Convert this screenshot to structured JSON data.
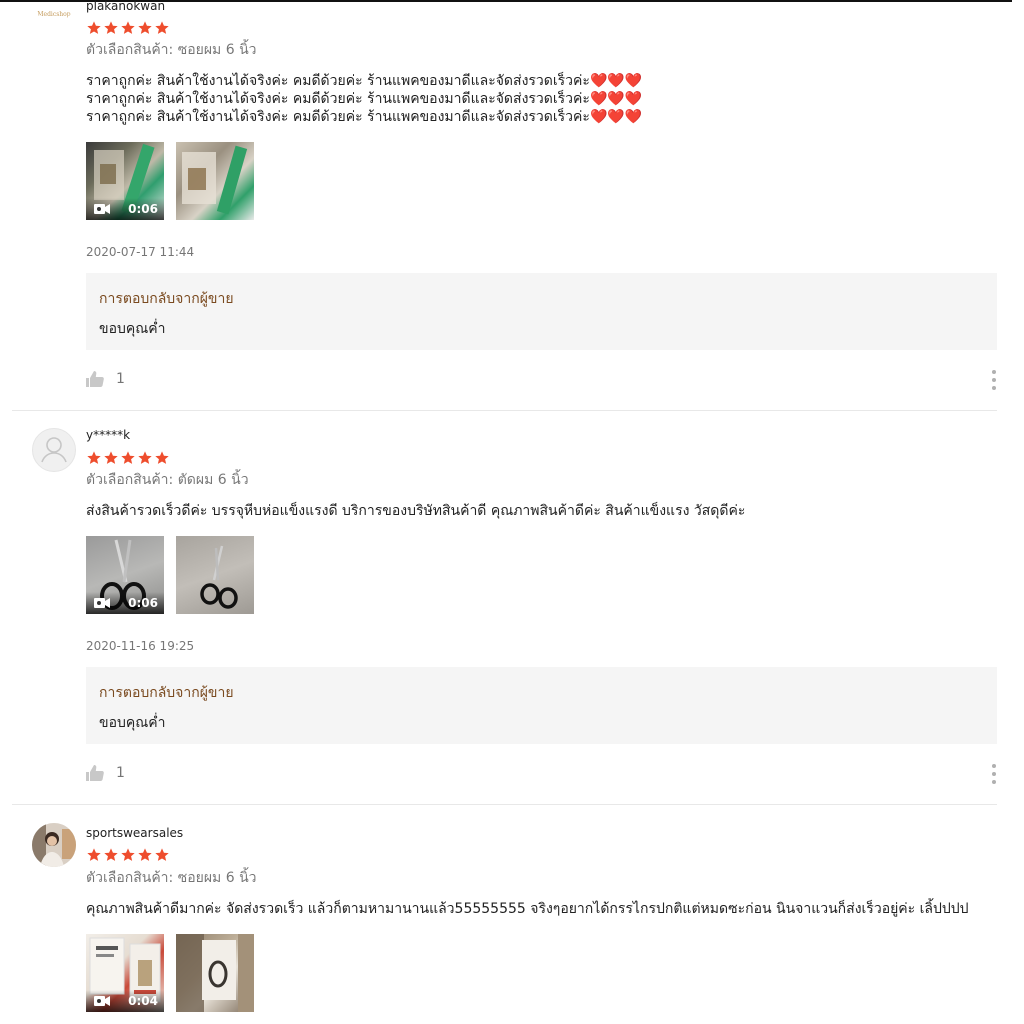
{
  "reviews": [
    {
      "username": "plakanokwan",
      "avatar_label": "Medicshop",
      "rating": 5,
      "variation": "ตัวเลือกสินค้า: ซอยผม 6 นิ้ว",
      "comment_lines": [
        "ราคาถูกค่ะ  สินค้าใช้งานได้จริงค่ะ คมดีด้วยค่ะ ร้านแพคของมาดีและจัดส่งรวดเร็วค่ะ",
        "ราคาถูกค่ะ  สินค้าใช้งานได้จริงค่ะ คมดีด้วยค่ะ ร้านแพคของมาดีและจัดส่งรวดเร็วค่ะ",
        "ราคาถูกค่ะ  สินค้าใช้งานได้จริงค่ะ คมดีด้วยค่ะ ร้านแพคของมาดีและจัดส่งรวดเร็วค่ะ"
      ],
      "hearts": "❤️❤️❤️",
      "video_duration": "0:06",
      "date": "2020-07-17 11:44",
      "reply_title": "การตอบกลับจากผู้ขาย",
      "reply_text": "ขอบคุณค่ำ",
      "likes": "1"
    },
    {
      "username": "y*****k",
      "rating": 5,
      "variation": "ตัวเลือกสินค้า: ตัดผม 6 นิ้ว",
      "comment": "ส่งสินค้ารวดเร็วดีค่ะ บรรจุหีบห่อแข็งแรงดี บริการของบริษัทสินค้าดี คุณภาพสินค้าดีค่ะ สินค้าแข็งแรง วัสดุดีค่ะ",
      "video_duration": "0:06",
      "date": "2020-11-16 19:25",
      "reply_title": "การตอบกลับจากผู้ขาย",
      "reply_text": "ขอบคุณค่ำ",
      "likes": "1"
    },
    {
      "username": "sportswearsales",
      "rating": 5,
      "variation": "ตัวเลือกสินค้า: ซอยผม 6 นิ้ว",
      "comment": "คุณภาพสินค้าดีมากค่ะ จัดส่งรวดเร็ว แล้วก็ตามหามานานแล้ว55555555 จริงๆอยากได้กรรไกรปกติแต่หมดซะก่อน นินจาแวนก็ส่งเร็วอยู่ค่ะ เลิ้ปปปป",
      "video_duration": "0:04"
    }
  ],
  "colors": {
    "star": "#ee4d2d",
    "reply_title": "#7a4a1f",
    "reply_bg": "#f5f5f5"
  },
  "icons": {
    "star": "star-icon",
    "video": "video-camera-icon",
    "like": "thumbs-up-icon",
    "more": "more-vertical-icon",
    "default_avatar": "user-icon"
  }
}
